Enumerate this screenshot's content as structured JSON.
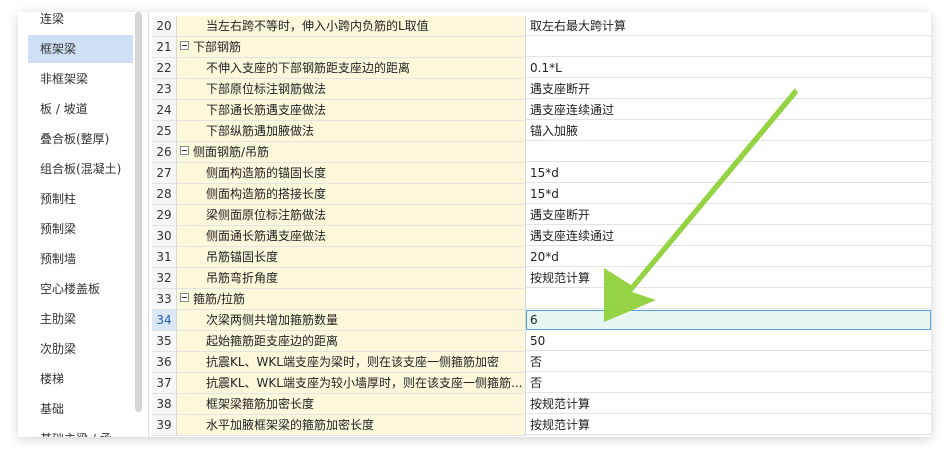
{
  "sidebar": {
    "items": [
      {
        "label": "连梁",
        "selected": false
      },
      {
        "label": "框架梁",
        "selected": true
      },
      {
        "label": "非框架梁",
        "selected": false
      },
      {
        "label": "板 / 坡道",
        "selected": false
      },
      {
        "label": "叠合板(整厚)",
        "selected": false
      },
      {
        "label": "组合板(混凝土)",
        "selected": false
      },
      {
        "label": "预制柱",
        "selected": false
      },
      {
        "label": "预制梁",
        "selected": false
      },
      {
        "label": "预制墙",
        "selected": false
      },
      {
        "label": "空心楼盖板",
        "selected": false
      },
      {
        "label": "主肋梁",
        "selected": false
      },
      {
        "label": "次肋梁",
        "selected": false
      },
      {
        "label": "楼梯",
        "selected": false
      },
      {
        "label": "基础",
        "selected": false
      },
      {
        "label": "基础主梁 / 承...",
        "selected": false
      }
    ]
  },
  "rows": [
    {
      "num": "20",
      "name": "当左右跨不等时，伸入小跨内负筋的L取值",
      "value": "取左右最大跨计算",
      "group": false
    },
    {
      "num": "21",
      "name": "下部钢筋",
      "value": "",
      "group": true
    },
    {
      "num": "22",
      "name": "不伸入支座的下部钢筋距支座边的距离",
      "value": "0.1*L",
      "group": false
    },
    {
      "num": "23",
      "name": "下部原位标注钢筋做法",
      "value": "遇支座断开",
      "group": false
    },
    {
      "num": "24",
      "name": "下部通长筋遇支座做法",
      "value": "遇支座连续通过",
      "group": false
    },
    {
      "num": "25",
      "name": "下部纵筋遇加腋做法",
      "value": "锚入加腋",
      "group": false
    },
    {
      "num": "26",
      "name": "侧面钢筋/吊筋",
      "value": "",
      "group": true
    },
    {
      "num": "27",
      "name": "侧面构造筋的锚固长度",
      "value": "15*d",
      "group": false
    },
    {
      "num": "28",
      "name": "侧面构造筋的搭接长度",
      "value": "15*d",
      "group": false
    },
    {
      "num": "29",
      "name": "梁侧面原位标注筋做法",
      "value": "遇支座断开",
      "group": false
    },
    {
      "num": "30",
      "name": "侧面通长筋遇支座做法",
      "value": "遇支座连续通过",
      "group": false
    },
    {
      "num": "31",
      "name": "吊筋锚固长度",
      "value": "20*d",
      "group": false
    },
    {
      "num": "32",
      "name": "吊筋弯折角度",
      "value": "按规范计算",
      "group": false
    },
    {
      "num": "33",
      "name": "箍筋/拉筋",
      "value": "",
      "group": true
    },
    {
      "num": "34",
      "name": "次梁两侧共增加箍筋数量",
      "value": "6",
      "group": false,
      "active": true
    },
    {
      "num": "35",
      "name": "起始箍筋距支座边的距离",
      "value": "50",
      "group": false
    },
    {
      "num": "36",
      "name": "抗震KL、WKL端支座为梁时，则在该支座一侧箍筋加密",
      "value": "否",
      "group": false
    },
    {
      "num": "37",
      "name": "抗震KL、WKL端支座为较小墙厚时，则在该支座一侧箍筋...",
      "value": "否",
      "group": false
    },
    {
      "num": "38",
      "name": "框架梁箍筋加密长度",
      "value": "按规范计算",
      "group": false
    },
    {
      "num": "39",
      "name": "水平加腋框架梁的箍筋加密长度",
      "value": "按规范计算",
      "group": false
    }
  ],
  "colors": {
    "arrow": "#8fd13a",
    "selected_sidebar": "#cfe0f6",
    "name_column": "#fdf8dc",
    "active_value": "#e7f6f3"
  }
}
